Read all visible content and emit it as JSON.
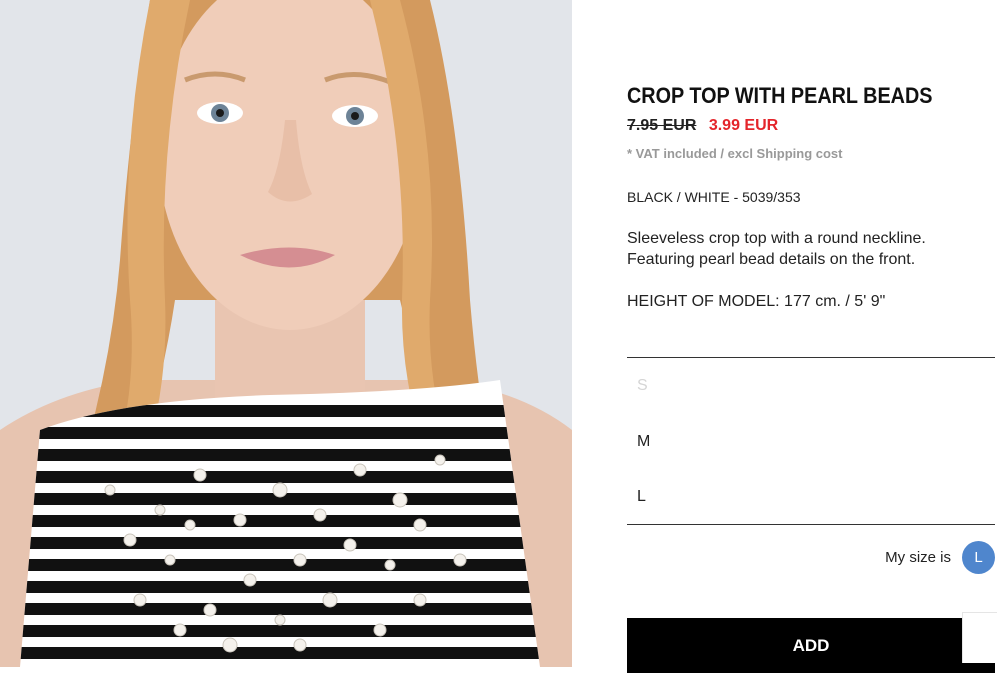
{
  "product": {
    "title": "CROP TOP WITH PEARL BEADS",
    "old_price": "7.95 EUR",
    "new_price": "3.99 EUR",
    "vat_note": "* VAT included / excl Shipping cost",
    "color_ref": "BLACK / WHITE - 5039/353",
    "description": [
      "Sleeveless crop top with a round neckline.",
      "Featuring pearl bead details on the front."
    ],
    "model_height": "HEIGHT OF MODEL: 177 cm. / 5' 9\""
  },
  "sizes": [
    {
      "label": "S",
      "available": false
    },
    {
      "label": "M",
      "available": true
    },
    {
      "label": "L",
      "available": true
    }
  ],
  "my_size": {
    "label": "My size is",
    "value": "L"
  },
  "add_button": {
    "label": "ADD"
  },
  "colors": {
    "sale_price": "#e4252b",
    "size_badge": "#4f86cd",
    "button_bg": "#000000"
  }
}
